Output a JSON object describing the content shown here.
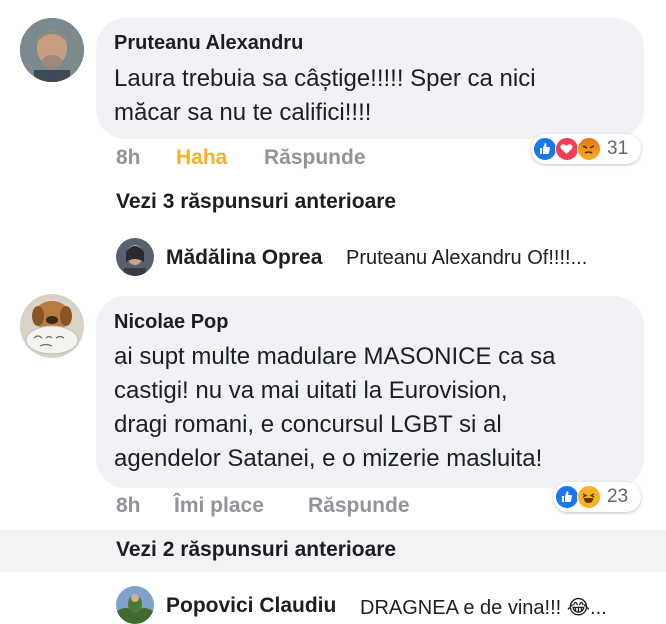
{
  "comments": [
    {
      "author": "Pruteanu Alexandru",
      "text_line1": "Laura trebuia sa câștige!!!!! Sper ca nici",
      "text_line2": "măcar sa nu te califici!!!!",
      "time": "8h",
      "reaction_label": "Haha",
      "reply_label": "Răspunde",
      "reactions": [
        "like",
        "love",
        "angry"
      ],
      "reaction_count": "31",
      "previous_replies": "Vezi 3 răspunsuri anterioare",
      "reply_preview": {
        "author": "Mădălina Oprea",
        "text": "Pruteanu Alexandru Of!!!!..."
      }
    },
    {
      "author": "Nicolae Pop",
      "text_line1": "ai supt multe madulare MASONICE ca sa",
      "text_line2": "castigi!  nu va mai uitati la Eurovision,",
      "text_line3": "dragi romani, e concursul LGBT si al",
      "text_line4": "agendelor Satanei, e o mizerie masluita!",
      "time": "8h",
      "like_label": "Îmi place",
      "reply_label": "Răspunde",
      "reactions": [
        "like",
        "haha"
      ],
      "reaction_count": "23",
      "previous_replies": "Vezi 2 răspunsuri anterioare",
      "reply_preview": {
        "author": "Popovici Claudiu",
        "text": "DRAGNEA e de vina!!! 😂..."
      }
    }
  ],
  "colors": {
    "haha_active": "#f7b125",
    "bubble": "#f0f2f5",
    "meta": "#90949c",
    "like": "#1877f2",
    "love": "#f33e58"
  }
}
